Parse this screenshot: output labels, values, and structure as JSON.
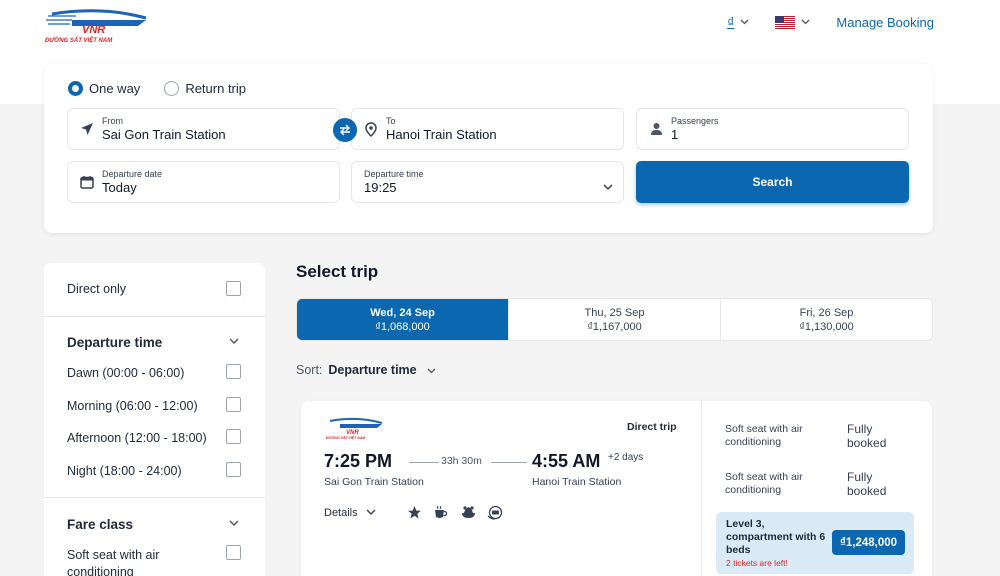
{
  "header": {
    "logo_text": "VNR",
    "logo_sub": "ĐƯỜNG SẮT VIỆT NAM",
    "currency": "₫",
    "manage_booking": "Manage Booking"
  },
  "search": {
    "trip_types": [
      {
        "label": "One way",
        "selected": true
      },
      {
        "label": "Return trip",
        "selected": false
      }
    ],
    "from_label": "From",
    "from_value": "Sai Gon Train Station",
    "to_label": "To",
    "to_value": "Hanoi Train Station",
    "passengers_label": "Passengers",
    "passengers_value": "1",
    "date_label": "Departure date",
    "date_value": "Today",
    "time_label": "Departure time",
    "time_value": "19:25",
    "search_label": "Search"
  },
  "filters": {
    "direct_only": "Direct only",
    "departure_title": "Departure time",
    "departure_options": [
      "Dawn (00:00 - 06:00)",
      "Morning (06:00 - 12:00)",
      "Afternoon (12:00 - 18:00)",
      "Night (18:00 - 24:00)"
    ],
    "fare_title": "Fare class",
    "fare_options": [
      "Soft seat with air conditioning"
    ]
  },
  "results": {
    "title": "Select trip",
    "dates": [
      {
        "day": "Wed, 24 Sep",
        "price": "₫1,068,000",
        "active": true
      },
      {
        "day": "Thu, 25 Sep",
        "price": "₫1,167,000",
        "active": false
      },
      {
        "day": "Fri, 26 Sep",
        "price": "₫1,130,000",
        "active": false
      }
    ],
    "sort_label": "Sort:",
    "sort_value": "Departure time"
  },
  "trip": {
    "logo_text": "VNR",
    "logo_sub": "ĐƯỜNG SẮT VIỆT NAM",
    "type": "Direct trip",
    "dep_time": "7:25 PM",
    "arr_time": "4:55 AM",
    "arr_plus": "+2 days",
    "duration": "33h 30m",
    "from_station": "Sai Gon Train Station",
    "to_station": "Hanoi Train Station",
    "details_label": "Details",
    "amenities": [
      "star-icon",
      "coffee-icon",
      "meal-icon",
      "ticket-icon"
    ],
    "classes": [
      {
        "name": "Soft seat with air conditioning",
        "status": "Fully booked"
      },
      {
        "name": "Soft seat with air conditioning",
        "status": "Fully booked"
      }
    ],
    "highlight": {
      "name": "Level 3, compartment with 6 beds",
      "warning": "2 tickets are left!",
      "price": "₫1,248,000"
    }
  },
  "colors": {
    "accent": "#0b67b0",
    "warning": "#dc2626",
    "highlight_bg": "#dbeaf7"
  }
}
